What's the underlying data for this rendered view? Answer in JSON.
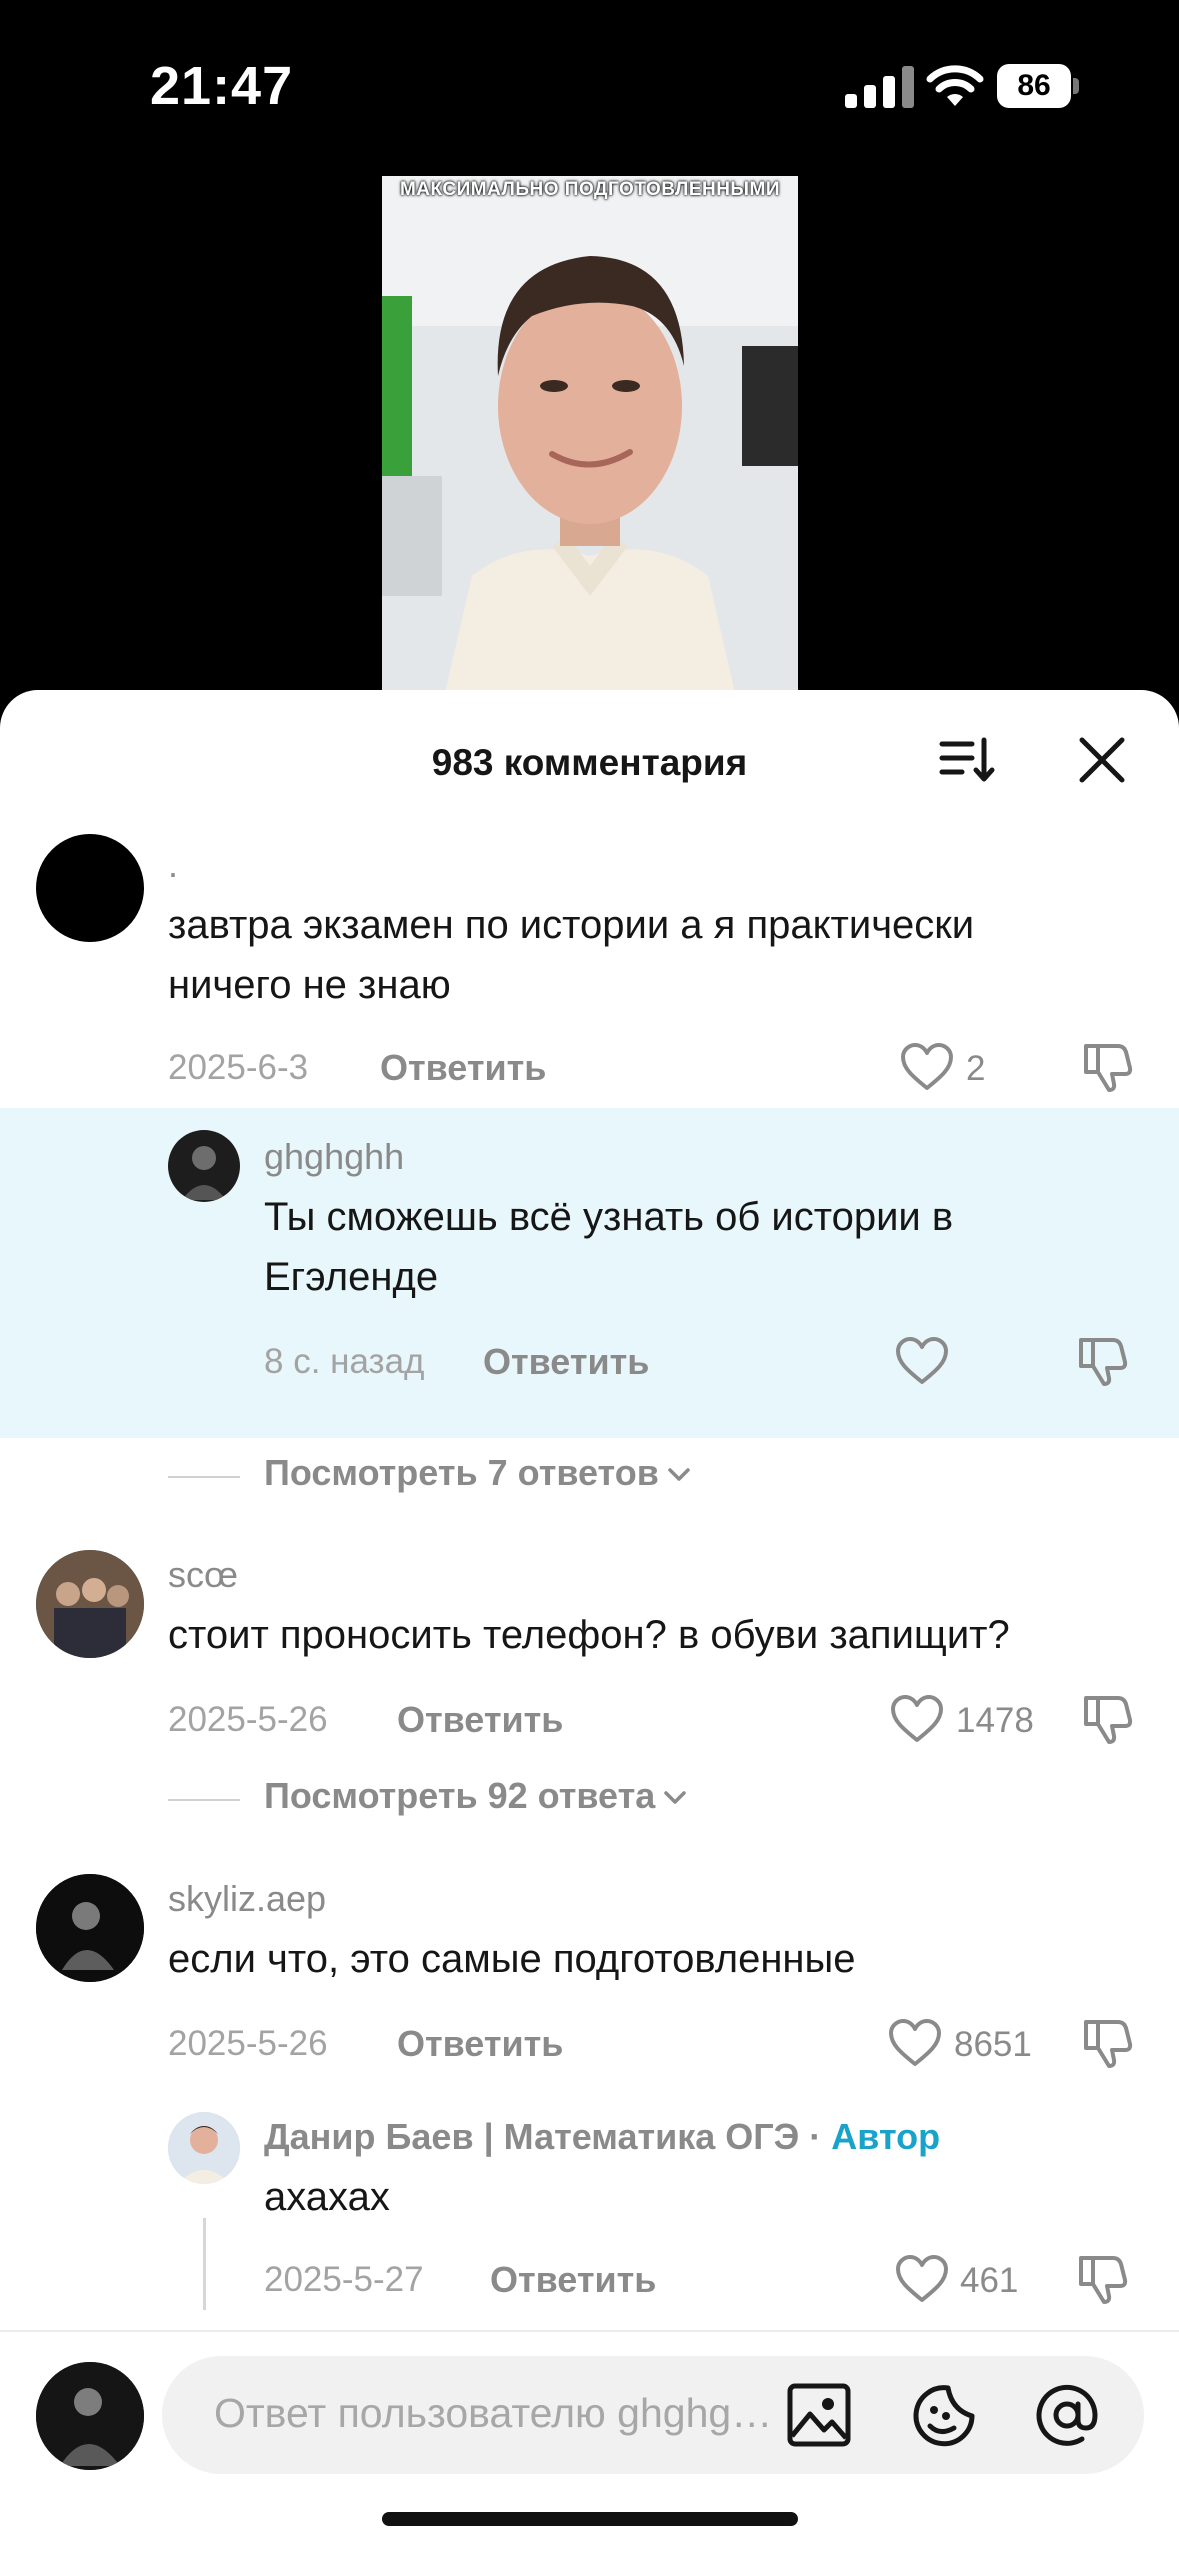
{
  "status_bar": {
    "time": "21:47",
    "battery": "86"
  },
  "video": {
    "caption": "МАКСИМАЛЬНО ПОДГОТОВЛЕННЫМИ"
  },
  "sheet": {
    "title": "983 комментария"
  },
  "comments": [
    {
      "username": ".",
      "text_lines": [
        "завтра экзамен по истории а я практически",
        "ничего не знаю"
      ],
      "date": "2025-6-3",
      "reply_label": "Ответить",
      "likes": "2",
      "replies": [
        {
          "username": "ghghghh",
          "text_lines": [
            "Ты сможешь всё узнать об истории в",
            "Егэленде"
          ],
          "date": "8 с. назад",
          "reply_label": "Ответить"
        }
      ],
      "view_replies": "Посмотреть 7 ответов"
    },
    {
      "username": "scœ",
      "text_lines": [
        "стоит проносить телефон? в обуви запищит?"
      ],
      "date": "2025-5-26",
      "reply_label": "Ответить",
      "likes": "1478",
      "view_replies": "Посмотреть 92 ответа"
    },
    {
      "username": "skyliz.aep",
      "text_lines": [
        "если что, это самые подготовленные"
      ],
      "date": "2025-5-26",
      "reply_label": "Ответить",
      "likes": "8651",
      "replies": [
        {
          "username": "Данир Баев | Математика ОГЭ ·",
          "author_badge": "Автор",
          "text_lines": [
            "ахахах"
          ],
          "date": "2025-5-27",
          "reply_label": "Ответить",
          "likes": "461"
        }
      ]
    }
  ],
  "composer": {
    "placeholder": "Ответ пользователю ghghghh"
  },
  "colors": {
    "accent": "#1aa3c9",
    "highlight": "#e8f7fb",
    "muted": "#8a8a8a"
  },
  "icons": [
    "signal-icon",
    "wifi-icon",
    "sort-icon",
    "close-icon",
    "heart-icon",
    "dislike-icon",
    "chevron-down-icon",
    "image-icon",
    "emoji-icon",
    "mention-icon"
  ]
}
